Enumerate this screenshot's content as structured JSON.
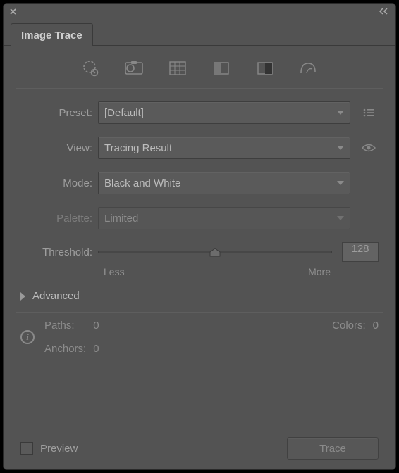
{
  "panel": {
    "title": "Image Trace"
  },
  "presets": {
    "icons": [
      "auto-color",
      "high-color",
      "low-color",
      "grayscale",
      "black-white",
      "outline"
    ]
  },
  "form": {
    "preset": {
      "label": "Preset:",
      "value": "[Default]"
    },
    "view": {
      "label": "View:",
      "value": "Tracing Result"
    },
    "mode": {
      "label": "Mode:",
      "value": "Black and White"
    },
    "palette": {
      "label": "Palette:",
      "value": "Limited"
    },
    "threshold": {
      "label": "Threshold:",
      "value": "128",
      "min_label": "Less",
      "max_label": "More"
    }
  },
  "advanced": {
    "label": "Advanced"
  },
  "info": {
    "paths": {
      "label": "Paths:",
      "value": "0"
    },
    "colors": {
      "label": "Colors:",
      "value": "0"
    },
    "anchors": {
      "label": "Anchors:",
      "value": "0"
    }
  },
  "bottom": {
    "preview_label": "Preview",
    "trace_label": "Trace"
  }
}
